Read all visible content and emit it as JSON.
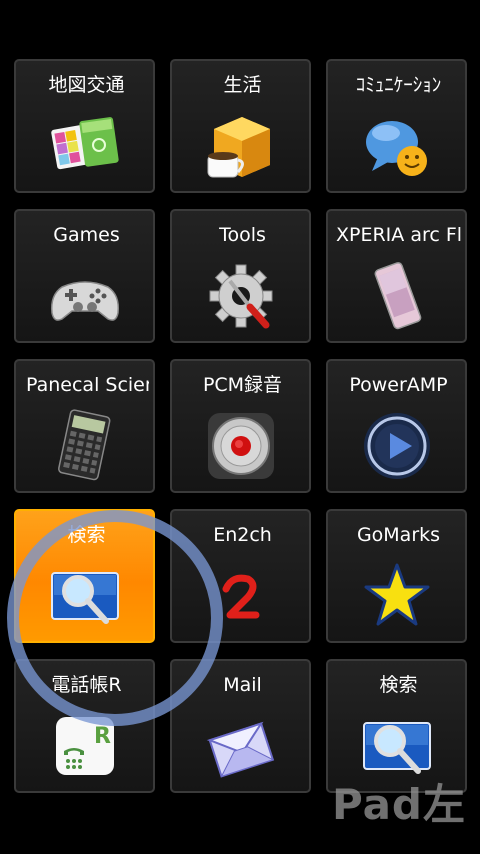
{
  "tiles": [
    {
      "label": "地図交通",
      "icon": "maps-folder-icon"
    },
    {
      "label": "生活",
      "icon": "coffee-box-icon"
    },
    {
      "label": "ｺﾐｭﾆｹｰｼｮﾝ",
      "icon": "chat-bubble-icon"
    },
    {
      "label": "Games",
      "icon": "gamepad-icon"
    },
    {
      "label": "Tools",
      "icon": "gear-wrench-icon"
    },
    {
      "label": "XPERIA arc Fl",
      "icon": "xperia-phone-icon"
    },
    {
      "label": "Panecal Scier",
      "icon": "calculator-icon"
    },
    {
      "label": "PCM録音",
      "icon": "record-button-icon"
    },
    {
      "label": "PowerAMP",
      "icon": "play-button-icon"
    },
    {
      "label": "検索",
      "icon": "search-magnifier-icon"
    },
    {
      "label": "En2ch",
      "icon": "en2ch-logo-icon"
    },
    {
      "label": "GoMarks",
      "icon": "star-icon"
    },
    {
      "label": "電話帳R",
      "icon": "phonebook-icon"
    },
    {
      "label": "Mail",
      "icon": "mail-envelope-icon"
    },
    {
      "label": "検索",
      "icon": "search-magnifier-icon"
    }
  ],
  "selected_index": 9,
  "pad_label": "Pad左",
  "colors": {
    "selected_tile": "#ff8c00",
    "tile_border": "#3a3a3a",
    "ring": "#7896d2"
  }
}
